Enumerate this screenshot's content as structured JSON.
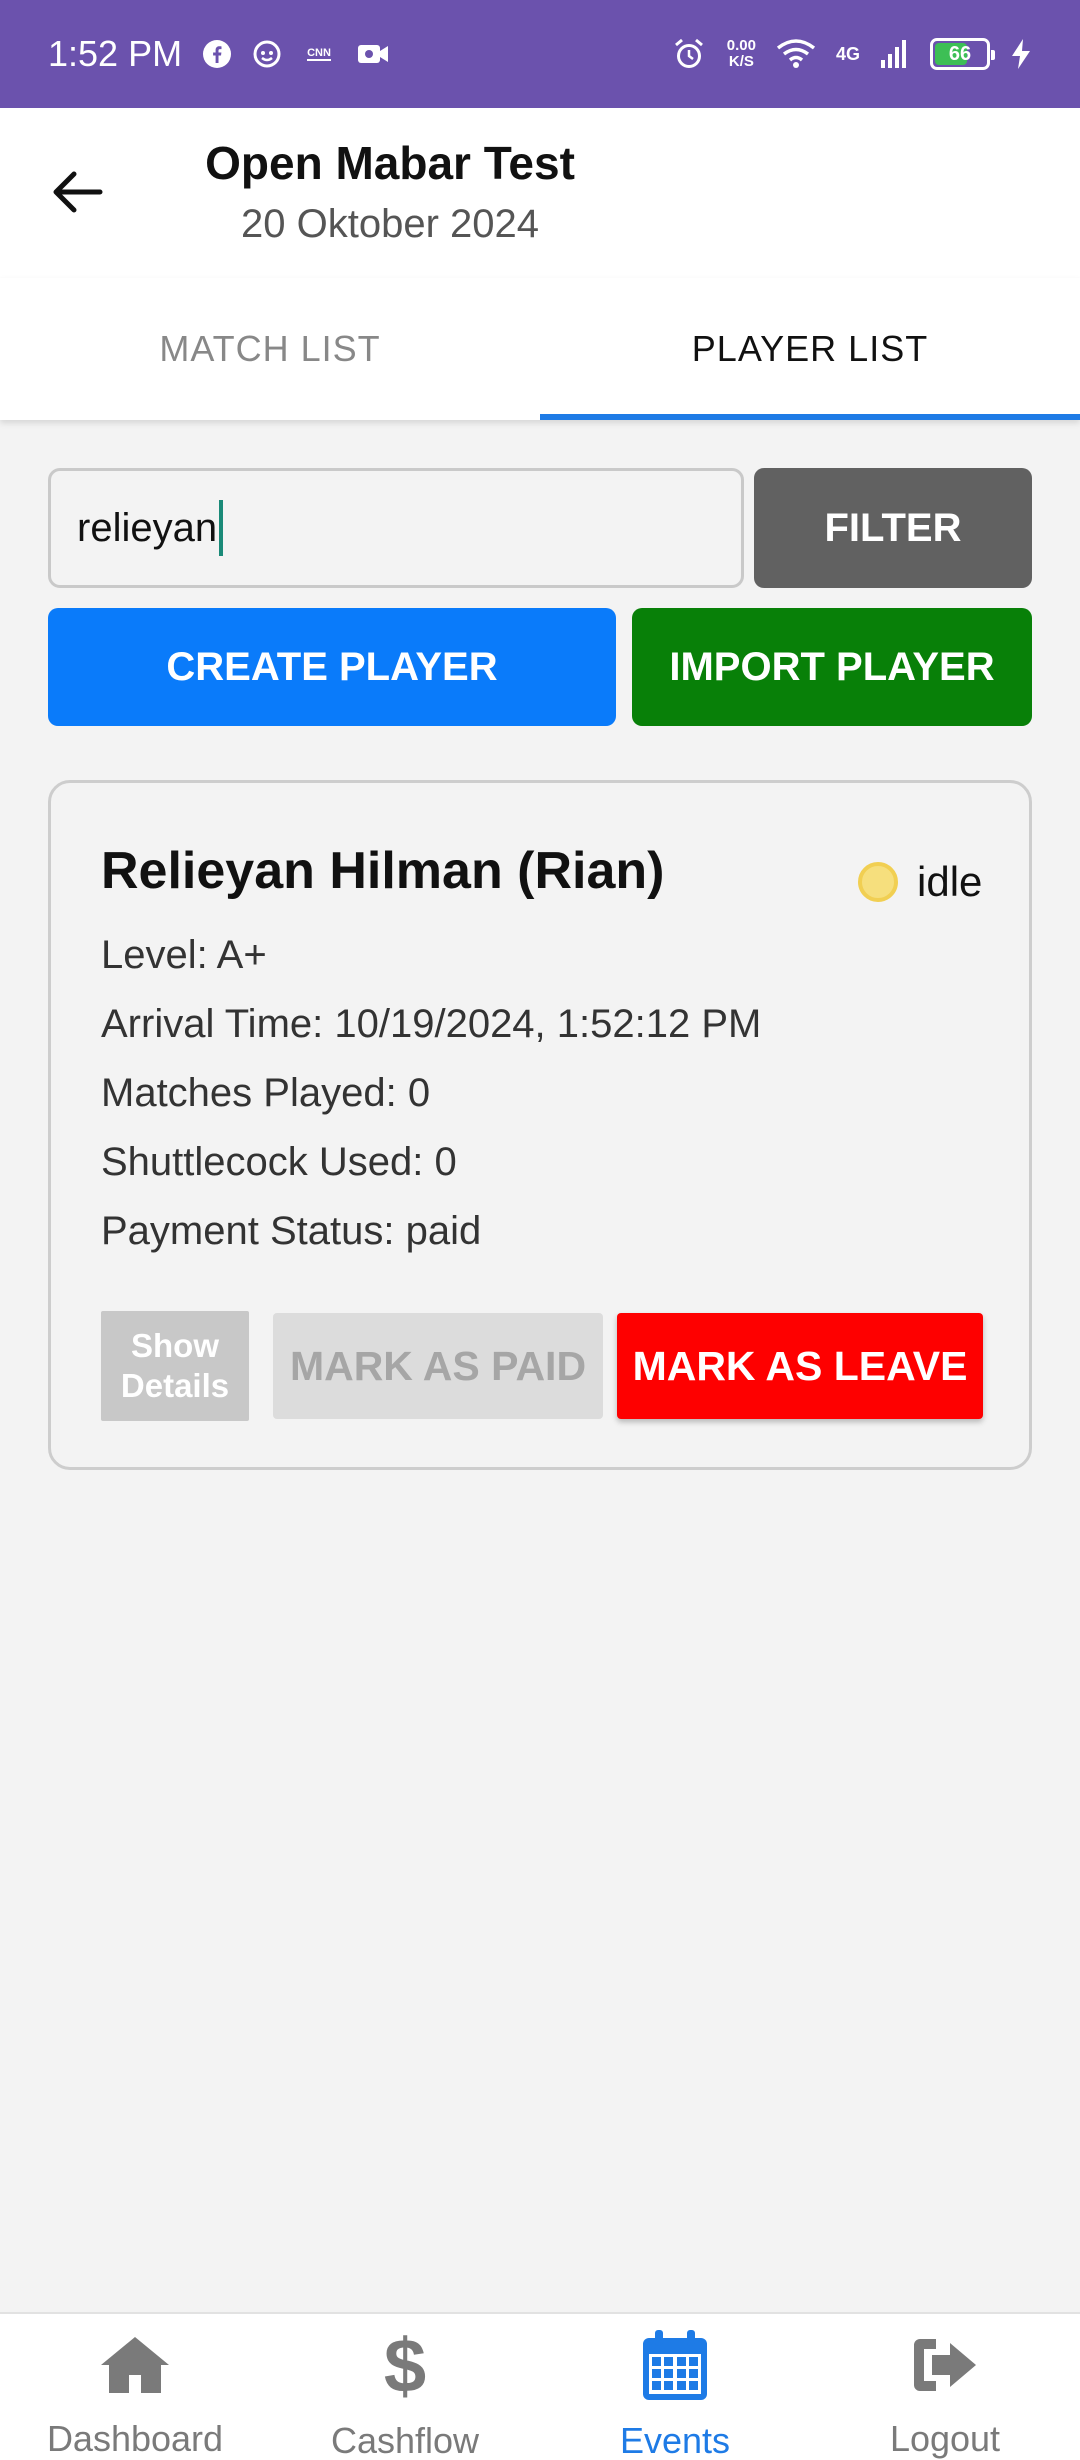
{
  "status_bar": {
    "time": "1:52 PM",
    "speed_value": "0.00",
    "speed_unit": "K/S",
    "network": "4G",
    "battery": "66",
    "battery_level": 0.66,
    "bar_color": "#6b52ad"
  },
  "header": {
    "title": "Open Mabar Test",
    "subtitle": "20 Oktober 2024"
  },
  "tabs": [
    {
      "label": "MATCH LIST",
      "active": false
    },
    {
      "label": "PLAYER LIST",
      "active": true
    }
  ],
  "search": {
    "value": "relieyan",
    "filter_label": "FILTER"
  },
  "actions": {
    "create_label": "CREATE PLAYER",
    "import_label": "IMPORT PLAYER"
  },
  "player": {
    "name": "Relieyan Hilman (Rian)",
    "status": "idle",
    "status_color": "#f6df7d",
    "level": "Level: A+",
    "arrival": "Arrival Time: 10/19/2024, 1:52:12 PM",
    "matches": "Matches Played: 0",
    "shuttlecock": "Shuttlecock Used: 0",
    "payment": "Payment Status: paid",
    "show_details_line1": "Show",
    "show_details_line2": "Details",
    "mark_paid_label": "MARK AS PAID",
    "mark_leave_label": "MARK AS LEAVE"
  },
  "bottom_nav": [
    {
      "label": "Dashboard",
      "icon": "home-icon",
      "active": false
    },
    {
      "label": "Cashflow",
      "icon": "dollar-icon",
      "active": false
    },
    {
      "label": "Events",
      "icon": "calendar-icon",
      "active": true
    },
    {
      "label": "Logout",
      "icon": "logout-icon",
      "active": false
    }
  ],
  "colors": {
    "accent": "#1e7be6",
    "create": "#0a7bfa",
    "import": "#088008",
    "leave": "#fe0000",
    "filter": "#616161"
  }
}
